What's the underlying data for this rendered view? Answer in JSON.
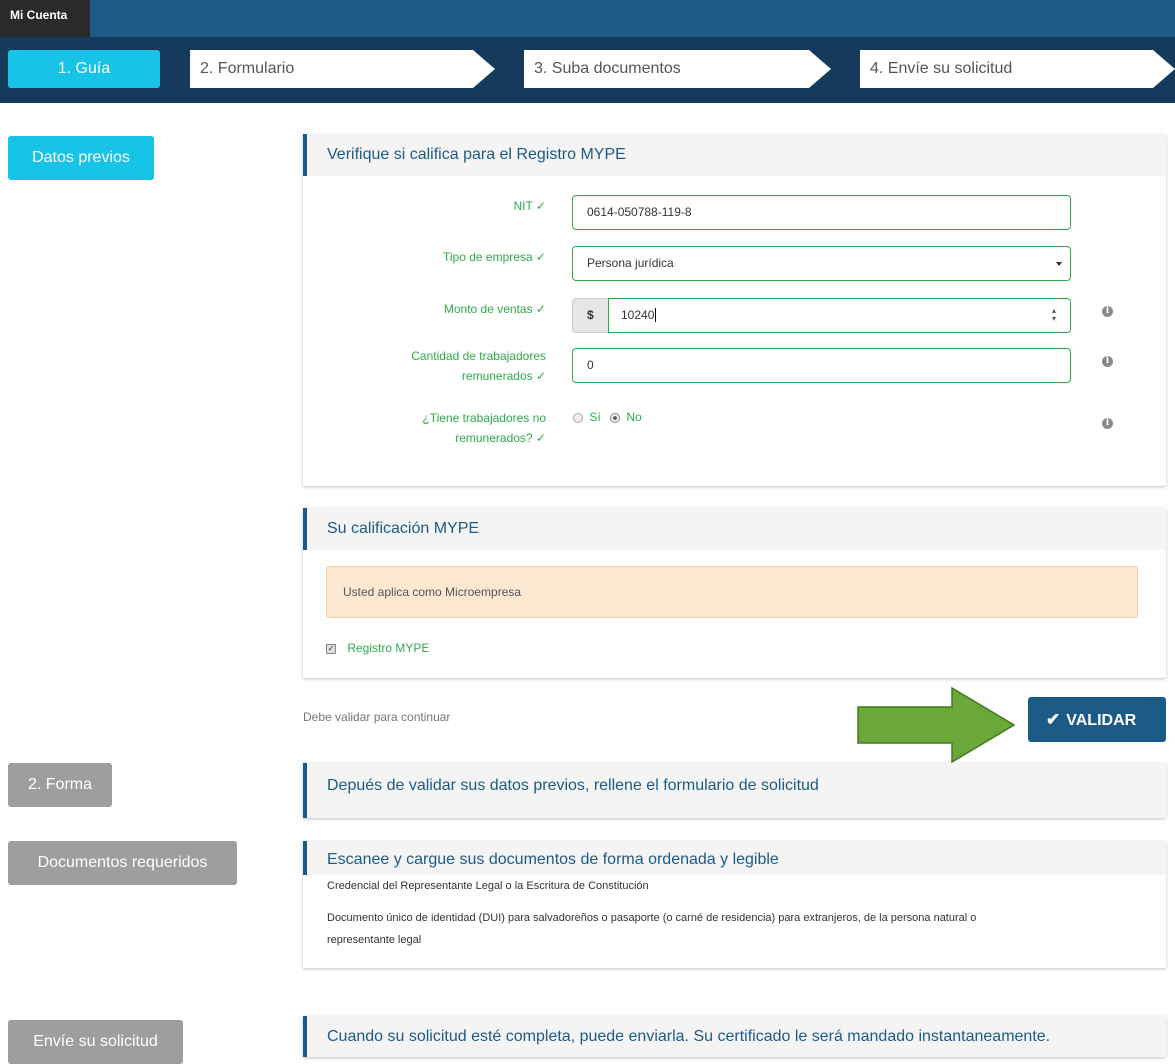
{
  "nav": {
    "tab_label": "Mi Cuenta"
  },
  "steps": [
    {
      "label": "1. Guía"
    },
    {
      "label": "2. Formulario"
    },
    {
      "label": "3. Suba documentos"
    },
    {
      "label": "4. Envíe su solicitud"
    }
  ],
  "sidebar": {
    "datos_previos": "Datos previos",
    "forma": "2. Forma",
    "documentos": "Documentos requeridos",
    "envie": "Envíe su solicitud"
  },
  "form_panel": {
    "title": "Verifique si califica para el Registro MYPE",
    "nit_label": "NIT ✓",
    "nit_value": "0614-050788-119-8",
    "tipo_label": "Tipo de empresa ✓",
    "tipo_value": "Persona jurídica",
    "monto_label": "Monto de ventas ✓",
    "monto_prefix": "$",
    "monto_value": "10240",
    "cantidad_label_1": "Cantidad de trabajadores",
    "cantidad_label_2": "remunerados ✓",
    "cantidad_value": "0",
    "no_rem_label_1": "¿Tiene trabajadores no",
    "no_rem_label_2": "remunerados? ✓",
    "radio_si": "Sí",
    "radio_no": "No",
    "selected_radio": "No"
  },
  "calificacion_panel": {
    "title": "Su calificación MYPE",
    "alert_text": "Usted aplica como Microempresa",
    "checkbox_label": "Registro MYPE",
    "checkbox_checked": true
  },
  "validate": {
    "hint": "Debe validar para continuar",
    "button_label": "VALIDAR"
  },
  "forma_panel": {
    "title": "Depués de validar sus datos previos, rellene el formulario de solicitud"
  },
  "documentos_panel": {
    "title": "Escanee y cargue sus documentos de forma ordenada y legible",
    "items": [
      "Credencial del Representante Legal o la Escritura de Constitución",
      "Documento único de identidad (DUI) para salvadoreños o pasaporte (o carné de residencia) para extranjeros, de la persona natural o",
      "representante legal"
    ]
  },
  "envie_panel": {
    "title": "Cuando su solicitud esté completa, puede enviarla. Su certificado le será mandado instantaneamente."
  },
  "colors": {
    "accent_cyan": "#17c3e6",
    "nav_blue": "#1b5b86",
    "success_green": "#2eaa4a",
    "arrow_green": "#6aa83a"
  }
}
